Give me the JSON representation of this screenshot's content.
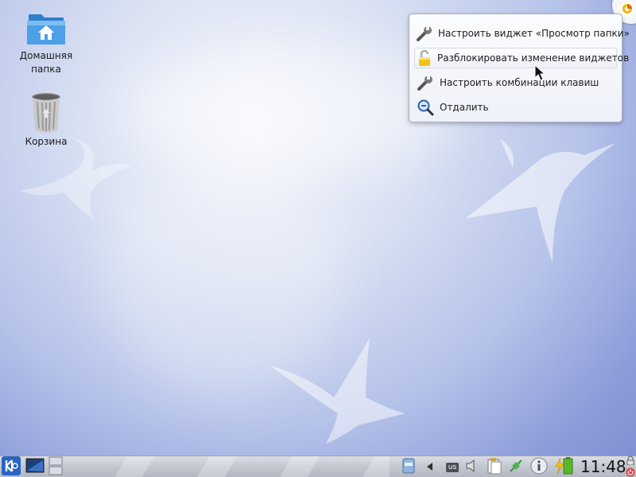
{
  "desktop": {
    "icons": [
      {
        "label_line1": "Домашняя",
        "label_line2": "папка",
        "icon": "home-folder-icon"
      },
      {
        "label_line1": "Корзина",
        "label_line2": "",
        "icon": "trash-icon"
      }
    ]
  },
  "context_menu": {
    "items": [
      {
        "label": "Настроить виджет «Просмотр папки»",
        "icon": "wrench-icon"
      },
      {
        "label": "Разблокировать изменение виджетов",
        "icon": "unlock-icon"
      },
      {
        "label": "Настроить комбинации клавиш",
        "icon": "wrench-icon"
      },
      {
        "label": "Отдалить",
        "icon": "zoom-out-icon"
      }
    ]
  },
  "panel": {
    "keyboard_layout": "us",
    "clock": "11:48"
  },
  "colors": {
    "kde_blue": "#2a64c6",
    "folder_blue": "#3a8fd8",
    "battery_green": "#59b829"
  }
}
